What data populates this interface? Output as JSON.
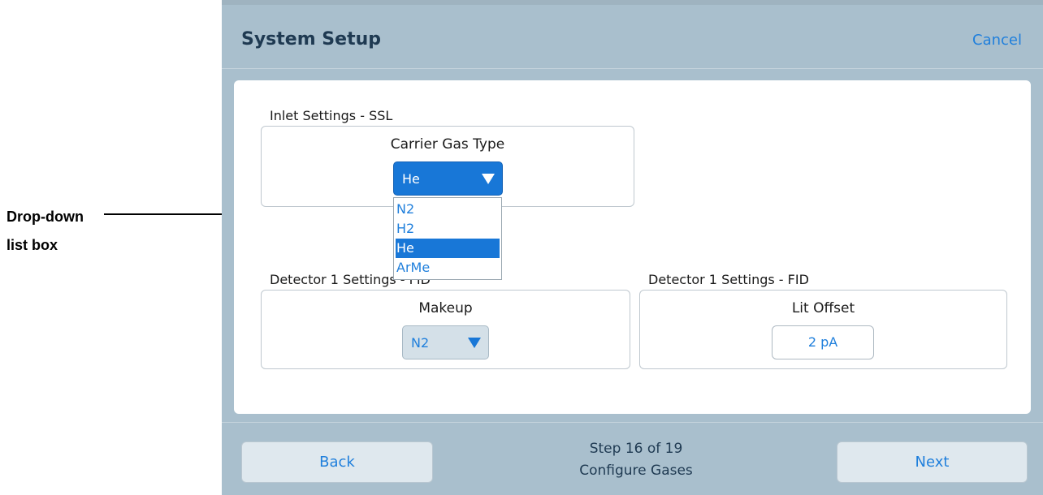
{
  "annotation": {
    "label_line1": "Drop-down",
    "label_line2": "list box"
  },
  "header": {
    "title": "System Setup",
    "cancel_label": "Cancel"
  },
  "inlet": {
    "group_title": "Inlet Settings - SSL",
    "field_label": "Carrier Gas Type",
    "selected_value": "He",
    "options": [
      "N2",
      "H2",
      "He",
      "ArMe"
    ],
    "highlighted_option": "He"
  },
  "detector_left": {
    "group_title": "Detector 1 Settings - FID",
    "field_label": "Makeup",
    "selected_value": "N2"
  },
  "detector_right": {
    "group_title": "Detector 1 Settings - FID",
    "field_label": "Lit Offset",
    "value": "2 pA"
  },
  "footer": {
    "back_label": "Back",
    "next_label": "Next",
    "step_text": "Step 16 of 19",
    "step_name": "Configure Gases"
  },
  "colors": {
    "screen_bg": "#a9bfcd",
    "accent": "#1877d7",
    "link": "#1f7fdc",
    "title_text": "#1f3a52"
  },
  "icons": {
    "dropdown_arrow": "triangle-down-icon"
  }
}
